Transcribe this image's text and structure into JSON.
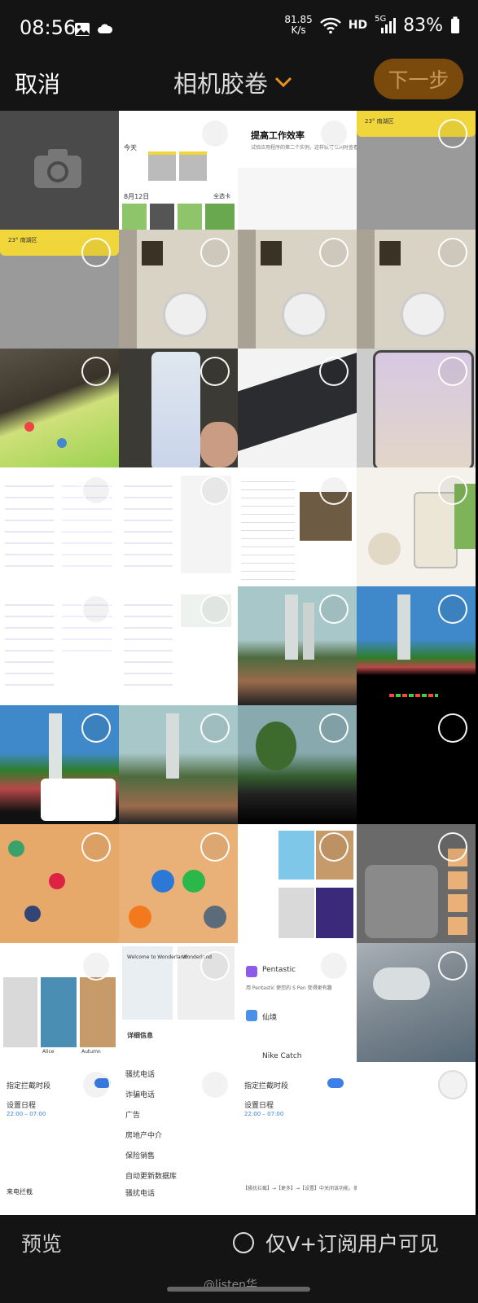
{
  "status_bar": {
    "time": "08:56",
    "net_speed_value": "81.85",
    "net_speed_unit": "K/s",
    "hd": "HD",
    "signal_label": "5G",
    "battery": "83%"
  },
  "header": {
    "cancel_label": "取消",
    "album_title": "相机胶卷",
    "next_label": "下一步"
  },
  "thumbnails": {
    "t1": {
      "title": "今天",
      "date": "8月12日",
      "more": "全选卡"
    },
    "t2": {
      "heading": "提高工作效率",
      "body": "试验应用程序的第二个实例，这样就可以同时查看零售..."
    },
    "t3": {
      "weather": "23° 南湖区"
    },
    "t4": {
      "weather": "23° 南湖区"
    },
    "t5": {
      "toggle_label": "指定拦截时段",
      "schedule_label": "设置日程",
      "schedule_time": "22:00 – 07:00"
    },
    "t6": {
      "info_title": "详细信息",
      "items": [
        "骚扰电话",
        "诈骗电话",
        "广告",
        "房地产中介",
        "保险销售",
        "自动更新数据库",
        "骚扰电话"
      ]
    },
    "t7": {
      "app1": "Pentastic",
      "app1_desc": "用 Pentastic 使您的 S Pen 变得更有趣",
      "app2": "仙境",
      "app3": "Nike Catch"
    },
    "t8": {
      "toggle_label": "指定拦截时段",
      "schedule_label": "设置日程",
      "schedule_time": "22:00 – 07:00"
    },
    "t9": {
      "app_name": "Wonderland",
      "welcome": "Welcome to Wonderland"
    },
    "t10": {
      "label_1": "Alice",
      "label_2": "Autumn"
    },
    "t11": {
      "block_title": "来电拦截"
    },
    "t12": {
      "footer": "【骚扰拦截】→【更多】→【设置】中关闭该功能。使用上述功能需使用..."
    }
  },
  "bottom_bar": {
    "preview_label": "预览",
    "visibility_label": "仅V+订阅用户可见",
    "watermark": "@listen华"
  }
}
